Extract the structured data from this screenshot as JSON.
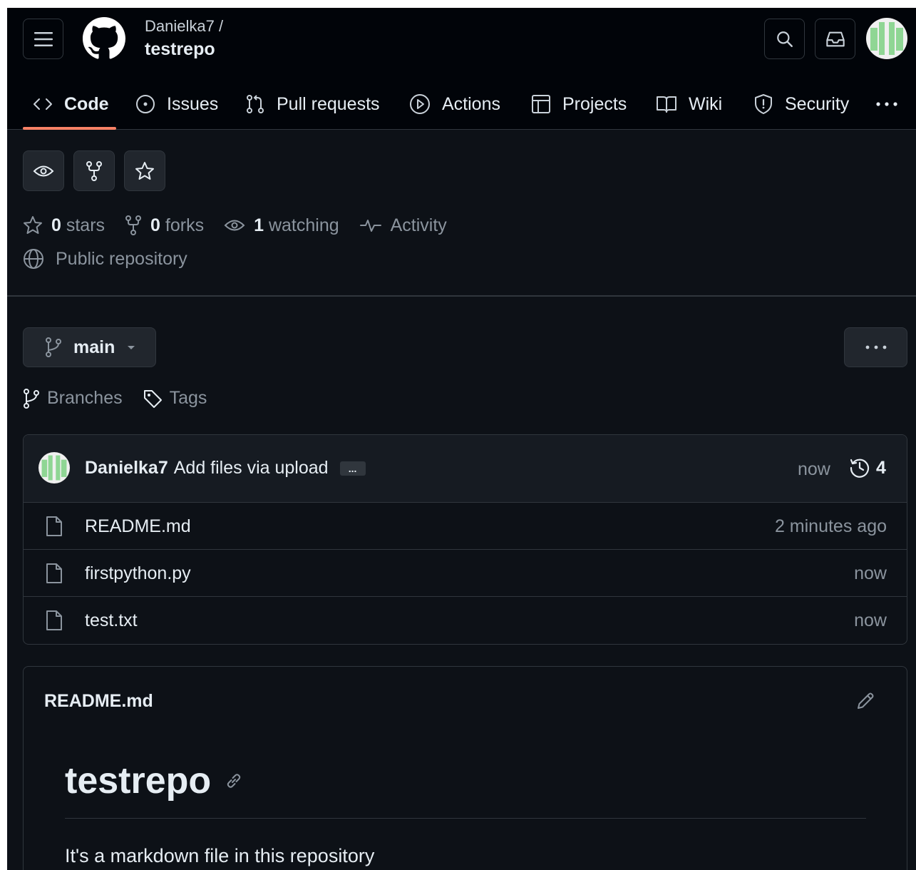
{
  "header": {
    "owner": "Danielka7 /",
    "repo": "testrepo"
  },
  "tabs": [
    {
      "label": "Code",
      "icon": "code-icon"
    },
    {
      "label": "Issues",
      "icon": "issue-icon"
    },
    {
      "label": "Pull requests",
      "icon": "pull-request-icon"
    },
    {
      "label": "Actions",
      "icon": "play-icon"
    },
    {
      "label": "Projects",
      "icon": "table-icon"
    },
    {
      "label": "Wiki",
      "icon": "book-icon"
    },
    {
      "label": "Security",
      "icon": "shield-icon"
    }
  ],
  "stats": {
    "stars_count": "0",
    "stars_label": "stars",
    "forks_count": "0",
    "forks_label": "forks",
    "watching_count": "1",
    "watching_label": "watching",
    "activity_label": "Activity",
    "visibility": "Public repository"
  },
  "branch": {
    "current": "main",
    "branches_label": "Branches",
    "tags_label": "Tags"
  },
  "commit": {
    "author": "Danielka7",
    "message": "Add files via upload",
    "ellipsis": "...",
    "time": "now",
    "count": "4"
  },
  "files": [
    {
      "name": "README.md",
      "time": "2 minutes ago"
    },
    {
      "name": "firstpython.py",
      "time": "now"
    },
    {
      "name": "test.txt",
      "time": "now"
    }
  ],
  "readme": {
    "title": "README.md",
    "heading": "testrepo",
    "paragraph": "It's a markdown file in this repository"
  },
  "colors": {
    "background": "#0d1117",
    "header": "#010409",
    "border": "#30363d",
    "accent_underline": "#f78166",
    "avatar_green": "#8fd694"
  }
}
